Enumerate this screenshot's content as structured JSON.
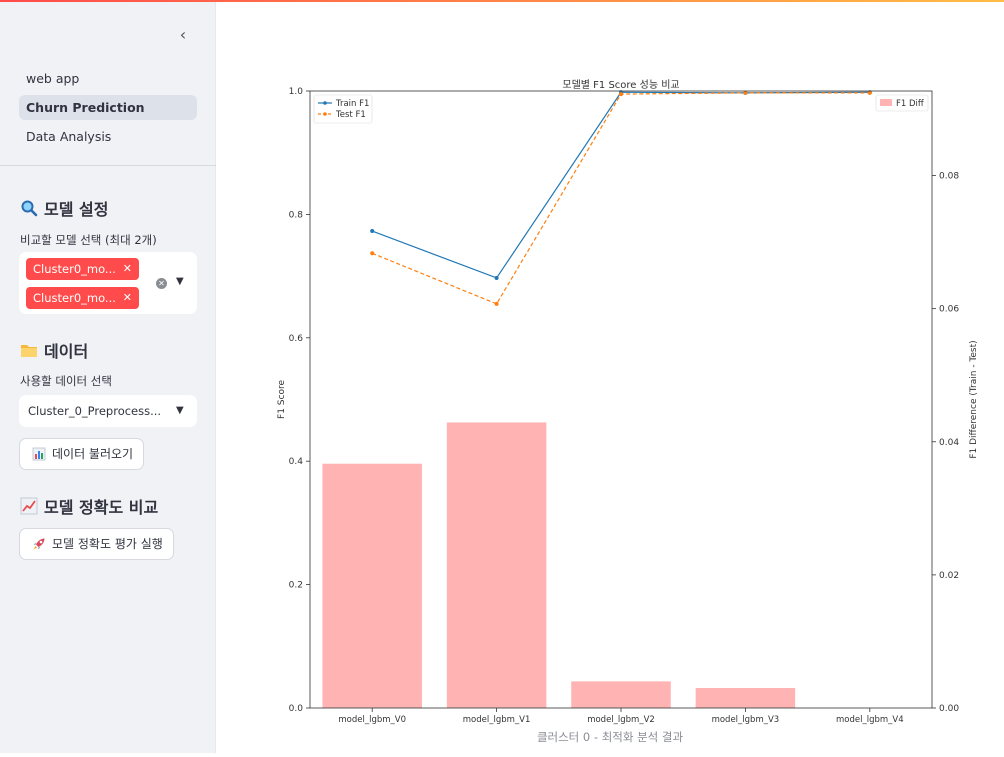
{
  "sidebar": {
    "nav": [
      {
        "label": "web app",
        "active": false
      },
      {
        "label": "Churn Prediction",
        "active": true
      },
      {
        "label": "Data Analysis",
        "active": false
      }
    ],
    "model_section": {
      "title": "모델 설정",
      "select_label": "비교할 모델 선택 (최대 2개)",
      "selected_models": [
        "Cluster0_mo...",
        "Cluster0_mo..."
      ]
    },
    "data_section": {
      "title": "데이터",
      "select_label": "사용할 데이터 선택",
      "selected_value": "Cluster_0_Preprocess...",
      "load_button": "데이터 불러오기"
    },
    "accuracy_section": {
      "title": "모델 정확도 비교",
      "run_button": "모델 정확도 평가 실행"
    }
  },
  "chart_data": {
    "type": "bar+line",
    "title": "모델별 F1 Score 성능 비교",
    "categories": [
      "model_lgbm_V0",
      "model_lgbm_V1",
      "model_lgbm_V2",
      "model_lgbm_V3",
      "model_lgbm_V4"
    ],
    "series": [
      {
        "name": "Train F1",
        "type": "line",
        "axis": "left",
        "color": "#1f77b4",
        "values": [
          0.773,
          0.697,
          0.998,
          0.997,
          0.998
        ]
      },
      {
        "name": "Test F1",
        "type": "line",
        "axis": "left",
        "color": "#ff7f0e",
        "dashed": true,
        "values": [
          0.737,
          0.655,
          0.995,
          0.997,
          0.997
        ]
      },
      {
        "name": "F1 Diff",
        "type": "bar",
        "axis": "right",
        "color": "#ffb3b3",
        "values": [
          0.0367,
          0.0429,
          0.004,
          0.003,
          0.0
        ]
      }
    ],
    "ylabel": "F1 Score",
    "y2label": "F1 Difference (Train - Test)",
    "ylim": [
      0.0,
      1.0
    ],
    "y2lim": [
      0.0,
      0.0927
    ],
    "yticks": [
      0.0,
      0.2,
      0.4,
      0.6,
      0.8,
      1.0
    ],
    "y2ticks": [
      0.0,
      0.02,
      0.04,
      0.06,
      0.08
    ],
    "ytick_labels": [
      "0.0",
      "0.2",
      "0.4",
      "0.6",
      "0.8",
      "1.0"
    ],
    "y2tick_labels": [
      "0.00",
      "0.02",
      "0.04",
      "0.06",
      "0.08"
    ],
    "legend_left": "top-left",
    "legend_right": "top-right"
  },
  "caption": "클러스터 0 - 최적화 분석 결과"
}
